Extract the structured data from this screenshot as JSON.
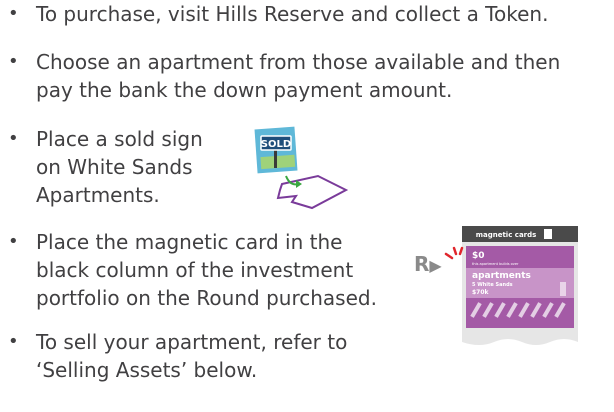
{
  "bullet_symbol": "•",
  "items": [
    {
      "lines": [
        "To purchase, visit Hills Reserve and collect a Token."
      ]
    },
    {
      "lines": [
        "Choose an apartment from those available and then",
        "pay the bank the down payment amount."
      ]
    },
    {
      "lines": [
        "Place a sold sign",
        "on White Sands",
        "Apartments."
      ]
    },
    {
      "lines": [
        "Place the magnetic card in the",
        "black column of the investment",
        "portfolio on the Round purchased."
      ]
    },
    {
      "lines": [
        "To sell your apartment, refer to",
        "‘Selling Assets’ below."
      ]
    }
  ],
  "sold_sign": {
    "label": "SOLD",
    "colors": {
      "sign": "#5fb8d8",
      "board": "#1f4e7a",
      "arrow": "#3aa640",
      "outline": "#7a3b9a"
    }
  },
  "round_marker": {
    "label": "R"
  },
  "magnetic_card": {
    "header": "magnetic cards",
    "price": "$0",
    "subtitle": "this apartment builds over",
    "category": "apartments",
    "name": "5 White Sands",
    "down_payment": "$70k",
    "colors": {
      "header": "#4a4a4a",
      "body": "#a45aa6",
      "band": "#c894c8"
    }
  }
}
